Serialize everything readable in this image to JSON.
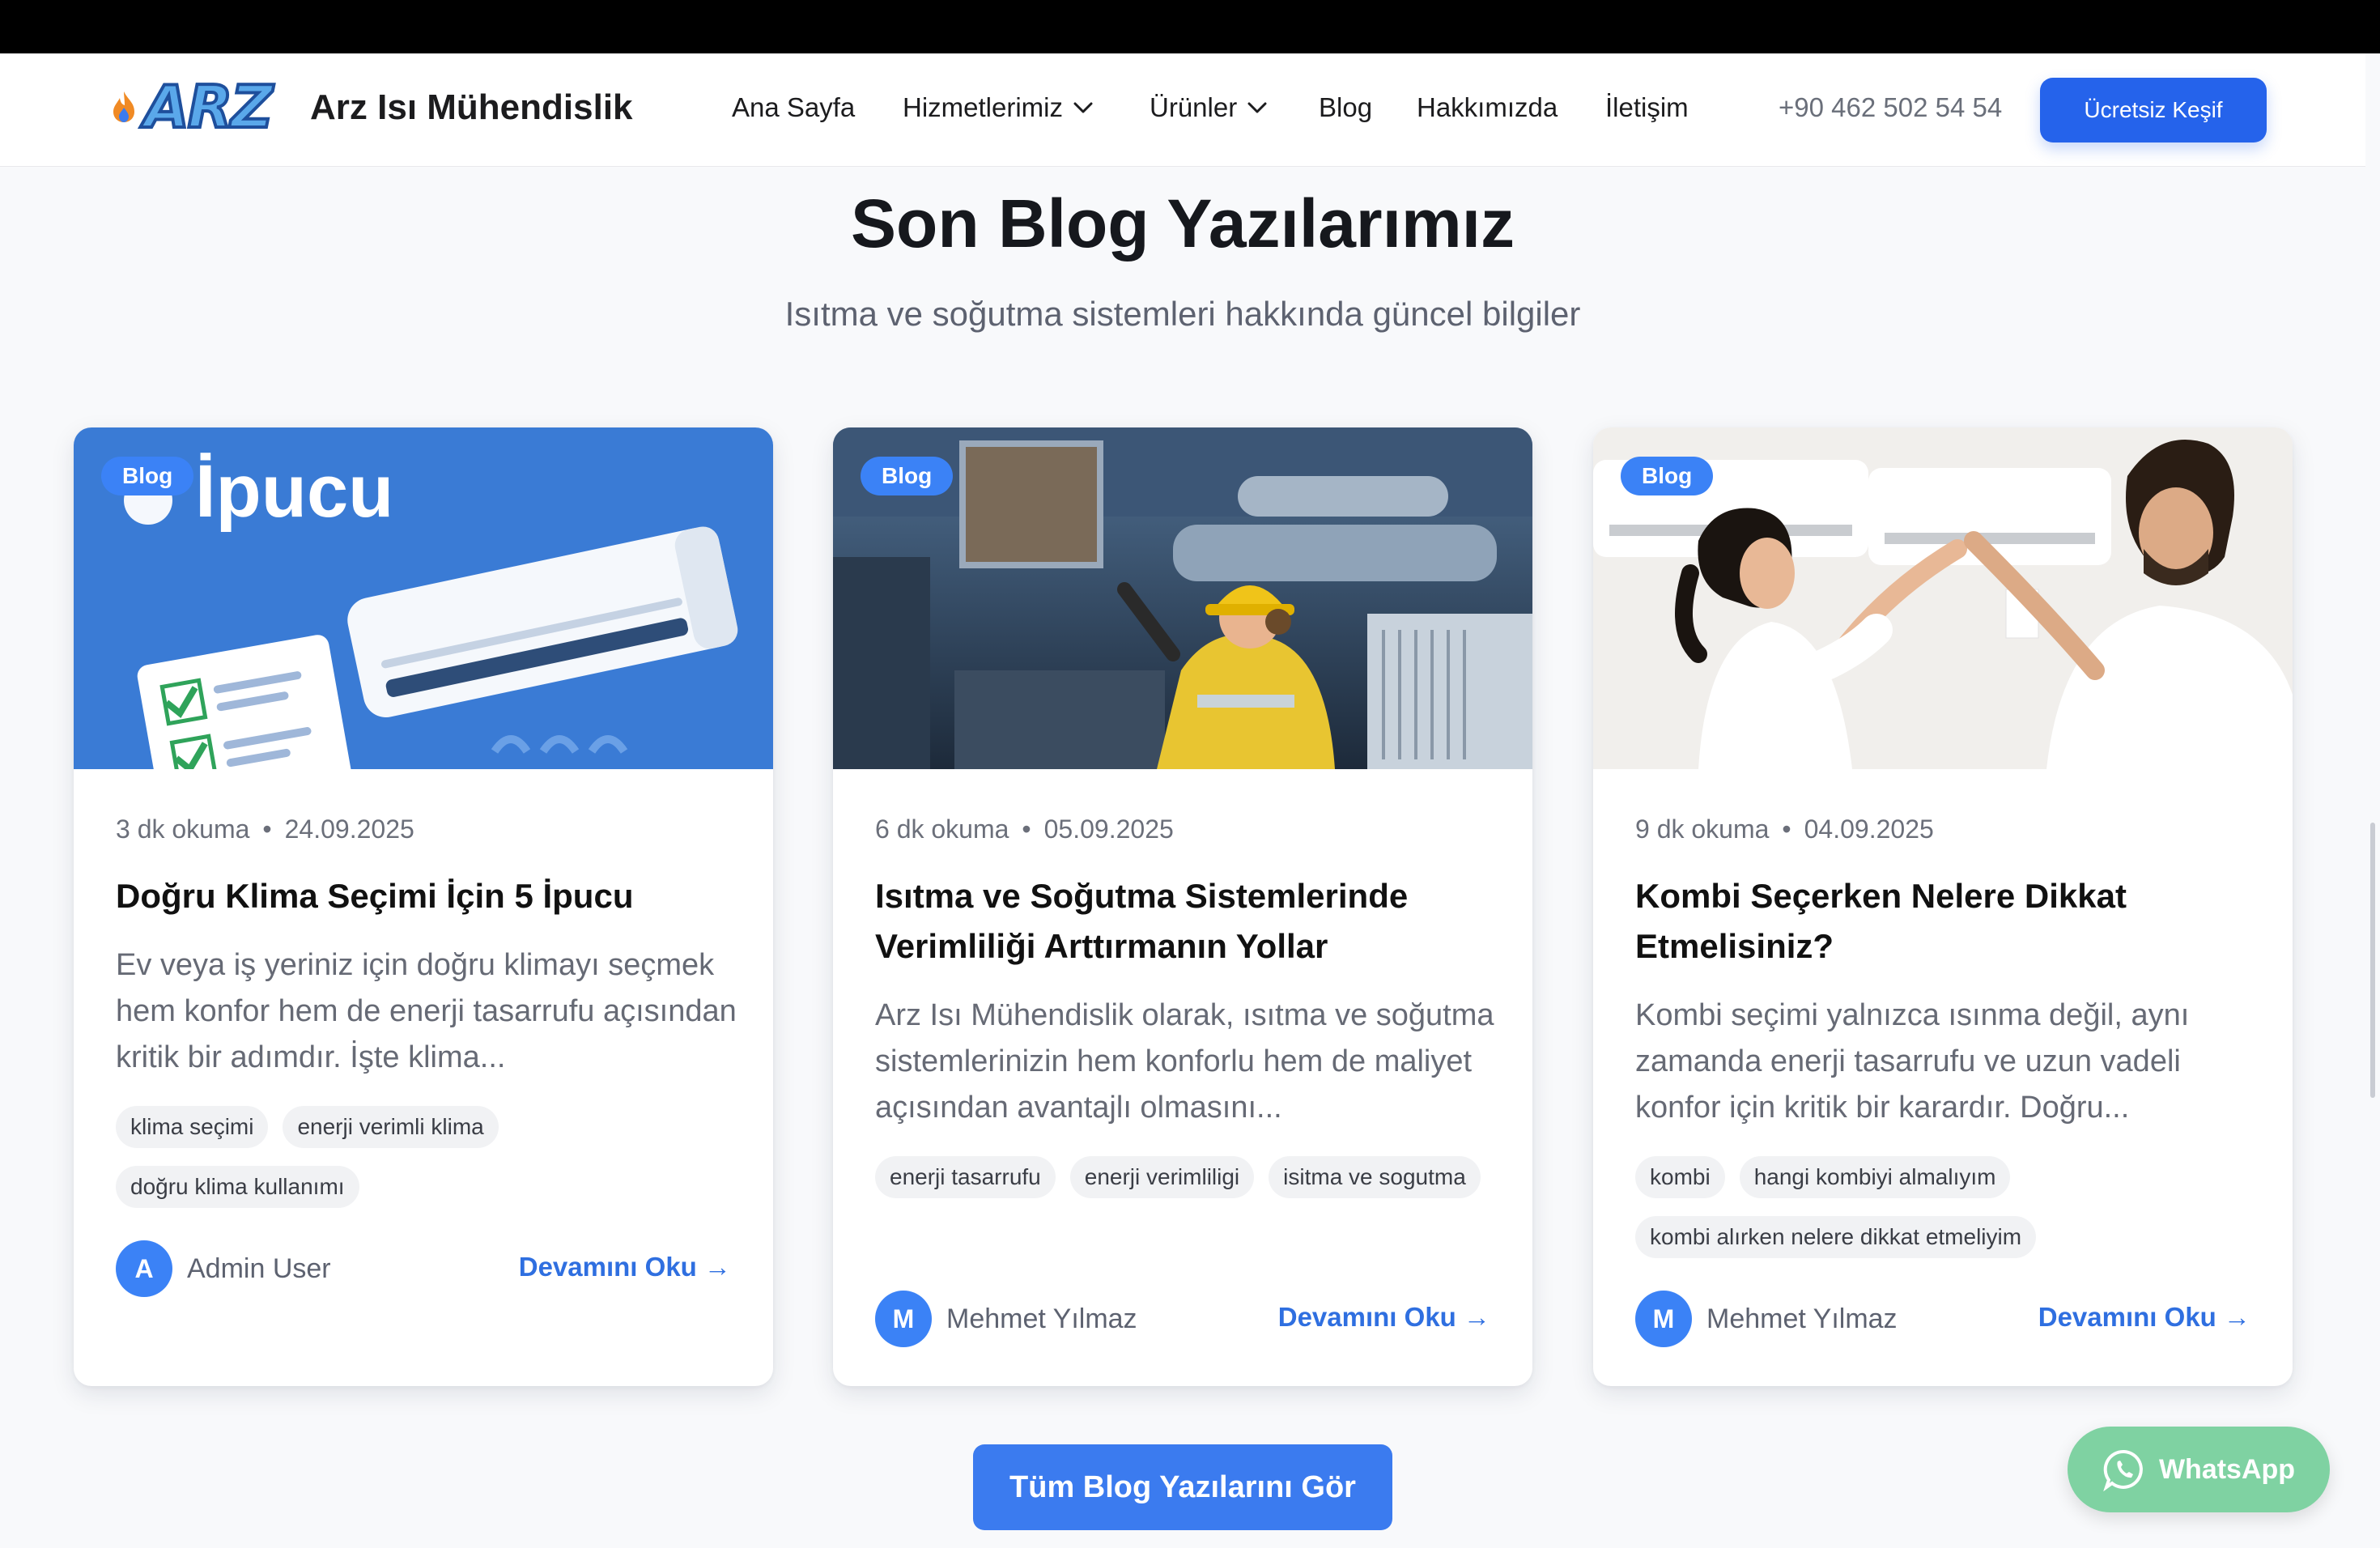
{
  "header": {
    "logo_text": "ARZ",
    "brand_name": "Arz Isı Mühendislik",
    "nav": [
      {
        "label": "Ana Sayfa"
      },
      {
        "label": "Hizmetlerimiz"
      },
      {
        "label": "Ürünler"
      },
      {
        "label": "Blog"
      },
      {
        "label": "Hakkımızda"
      },
      {
        "label": "İletişim"
      }
    ],
    "phone": "+90 462 502 54 54",
    "cta_label": "Ücretsiz Keşif"
  },
  "section": {
    "title": "Son Blog Yazılarımız",
    "subtitle": "Isıtma ve soğutma sistemleri hakkında güncel bilgiler"
  },
  "posts": [
    {
      "badge": "Blog",
      "image_text": "İpucu",
      "read_time": "3 dk okuma",
      "date": "24.09.2025",
      "title": "Doğru Klima Seçimi İçin 5 İpucu",
      "excerpt": "Ev veya iş yeriniz için doğru klimayı seçmek hem konfor hem de enerji tasarrufu açısından kritik bir adımdır. İşte klima...",
      "tags": [
        "klima seçimi",
        "enerji verimli klima",
        "doğru klima kullanımı"
      ],
      "author_initial": "A",
      "author": "Admin User",
      "read_more": "Devamını Oku →"
    },
    {
      "badge": "Blog",
      "read_time": "6 dk okuma",
      "date": "05.09.2025",
      "title": "Isıtma ve Soğutma Sistemlerinde Verimliliği Arttırmanın Yollar",
      "excerpt": "Arz Isı Mühendislik olarak, ısıtma ve soğutma sistemlerinizin hem konforlu hem de maliyet açısından avantajlı olmasını...",
      "tags": [
        "enerji tasarrufu",
        "enerji verimliligi",
        "isitma ve sogutma"
      ],
      "author_initial": "M",
      "author": "Mehmet Yılmaz",
      "read_more": "Devamını Oku →"
    },
    {
      "badge": "Blog",
      "read_time": "9 dk okuma",
      "date": "04.09.2025",
      "title": "Kombi Seçerken Nelere Dikkat Etmelisiniz?",
      "excerpt": "Kombi seçimi yalnızca ısınma değil, aynı zamanda enerji tasarrufu ve uzun vadeli konfor için kritik bir karardır. Doğru...",
      "tags": [
        "kombi",
        "hangi kombiyi almalıyım",
        "kombi alırken nelere dikkat etmeliyim"
      ],
      "author_initial": "M",
      "author": "Mehmet Yılmaz",
      "read_more": "Devamını Oku →"
    }
  ],
  "all_posts_label": "Tüm Blog Yazılarını Gör",
  "whatsapp_label": "WhatsApp",
  "colors": {
    "primary": "#2563eb",
    "badge": "#3b82f6",
    "link": "#2f6fe0",
    "whatsapp": "#7fd2a2"
  }
}
